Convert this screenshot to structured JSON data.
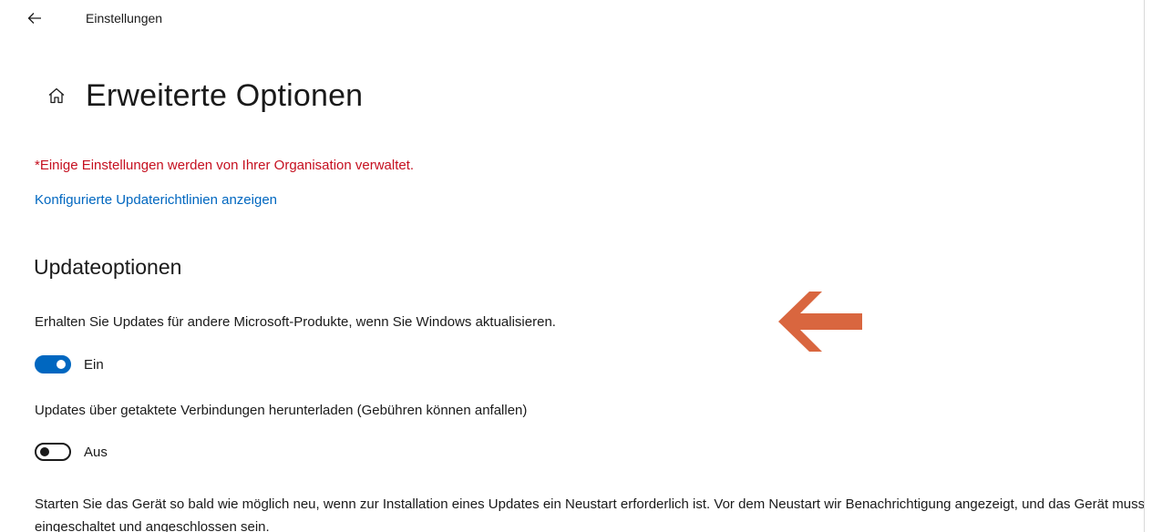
{
  "window": {
    "title": "Einstellungen"
  },
  "page": {
    "title": "Erweiterte Optionen"
  },
  "managed_notice": "*Einige Einstellungen werden von Ihrer Organisation verwaltet.",
  "policy_link": "Konfigurierte Updaterichtlinien anzeigen",
  "update_options": {
    "section_title": "Updateoptionen",
    "other_products": {
      "label": "Erhalten Sie Updates für andere Microsoft-Produkte, wenn Sie Windows aktualisieren.",
      "state": "Ein",
      "on": true
    },
    "metered": {
      "label": "Updates über getaktete Verbindungen herunterladen (Gebühren können anfallen)",
      "state": "Aus",
      "on": false
    },
    "restart_description": "Starten Sie das Gerät so bald wie möglich neu, wenn zur Installation eines Updates ein Neustart erforderlich ist. Vor dem Neustart wir Benachrichtigung angezeigt, und das Gerät muss eingeschaltet und angeschlossen sein."
  },
  "colors": {
    "accent": "#0067c0",
    "warning": "#c50f1f",
    "annotation_arrow": "#d9663f"
  },
  "icons": {
    "back": "back-arrow-icon",
    "home": "home-icon",
    "annotation": "left-arrow-annotation-icon"
  }
}
